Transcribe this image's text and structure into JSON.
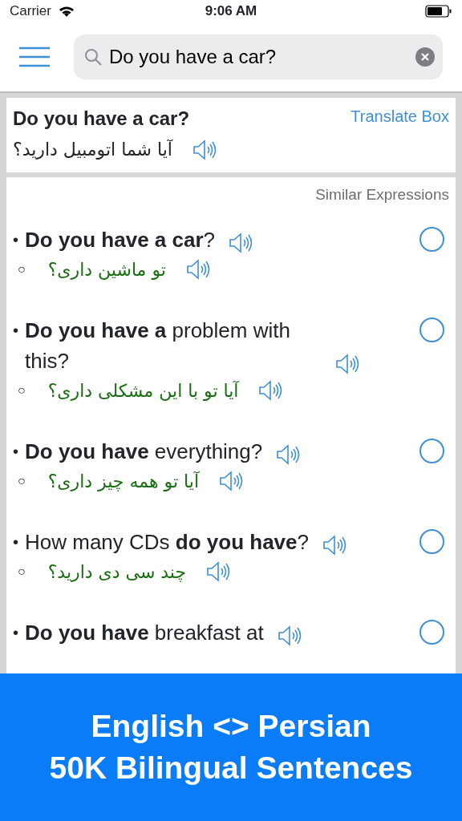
{
  "status_bar": {
    "carrier": "Carrier",
    "time": "9:06 AM"
  },
  "search": {
    "value": "Do you have a car?"
  },
  "main_entry": {
    "english": "Do you have a car?",
    "persian": "آیا شما اتومبیل دارید؟",
    "link": "Translate Box"
  },
  "similar": {
    "heading": "Similar Expressions",
    "items": [
      {
        "marker": "•",
        "english": "**Do you have a car**?",
        "translation_marker": "○",
        "persian": "تو ماشین داری؟",
        "selected": false
      },
      {
        "marker": "•",
        "english": "**Do you have a** problem with this?",
        "translation_marker": "○",
        "persian": "آیا تو با این مشکلی داری؟",
        "selected": false
      },
      {
        "marker": "•",
        "english": "**Do you have** everything?",
        "translation_marker": "○",
        "persian": "آیا تو همه چیز داری؟",
        "selected": false
      },
      {
        "marker": "•",
        "english": "How many CDs **do you have**?",
        "translation_marker": "○",
        "persian": "چند سی دی دارید؟",
        "selected": false
      },
      {
        "marker": "•",
        "english": "**Do you have** breakfast at",
        "selected": false
      }
    ]
  },
  "banner": {
    "lines": [
      "English <> Persian",
      "50K Bilingual Sentences"
    ]
  }
}
